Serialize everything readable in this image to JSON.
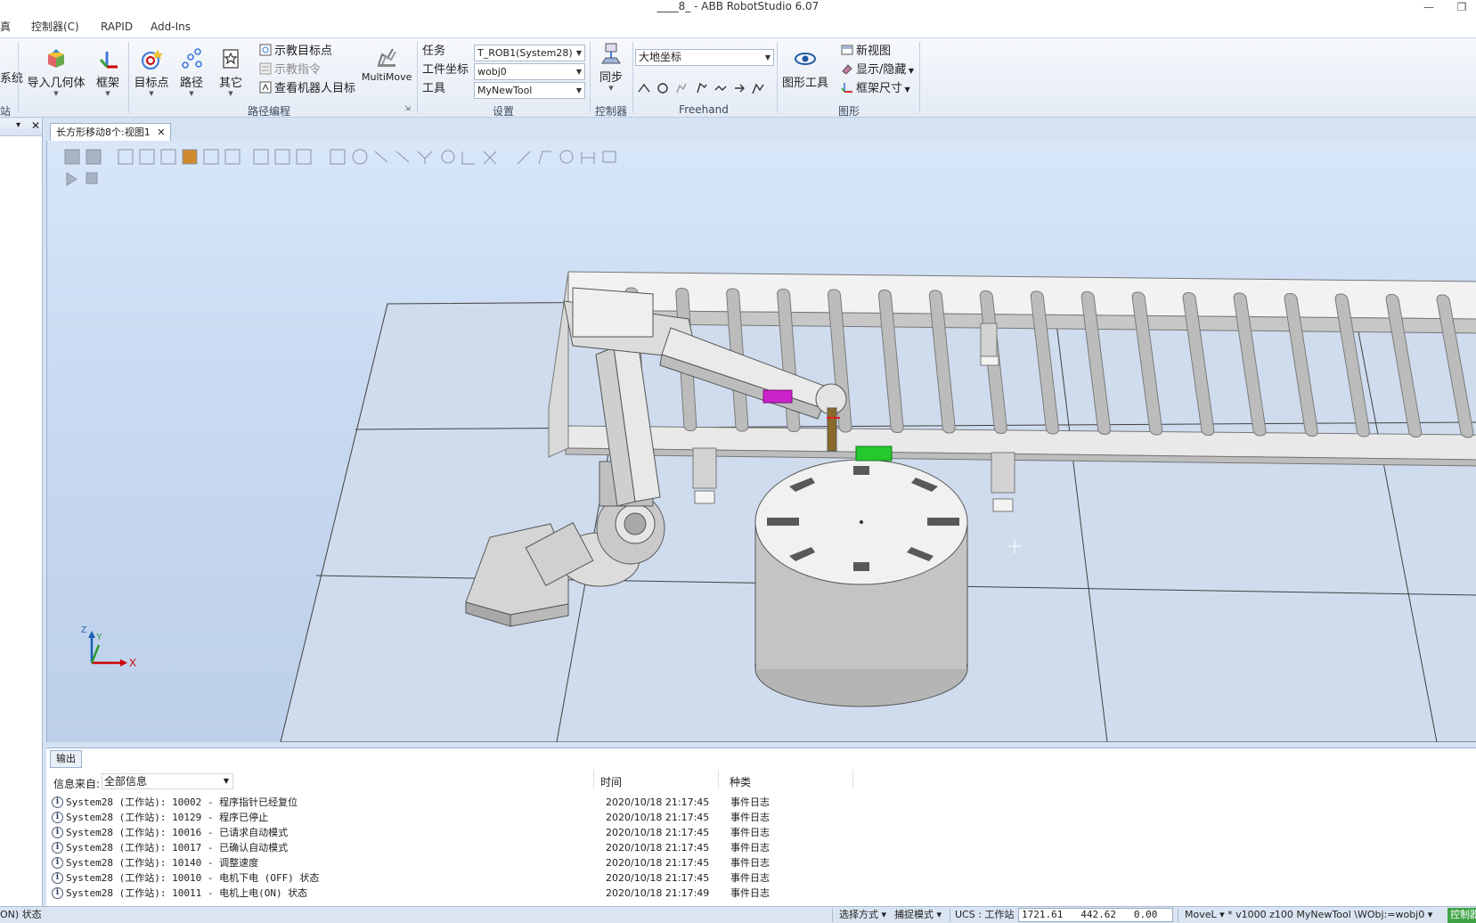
{
  "window": {
    "title": "____8_ - ABB RobotStudio 6.07",
    "minimize_glyph": "—",
    "restore_glyph": "❐"
  },
  "menu": {
    "tabs": [
      "真",
      "控制器(C)",
      "RAPID",
      "Add-Ins"
    ]
  },
  "ribbon": {
    "partial_left_label": "系统",
    "partial_group_label": "站",
    "import_geometry": "导入几何体",
    "frame": "框架",
    "target": "目标点",
    "path": "路径",
    "other": "其它",
    "teach_target": "示教目标点",
    "teach_instruction": "示教指令",
    "view_robot_target": "查看机器人目标",
    "multimove": "MultiMove",
    "group_path_programming": "路径编程",
    "task_label": "任务",
    "task_value": "T_ROB1(System28)",
    "wobj_label": "工件坐标",
    "wobj_value": "wobj0",
    "tool_label": "工具",
    "tool_value": "MyNewTool",
    "group_settings": "设置",
    "sync": "同步",
    "group_controller": "控制器",
    "ref_frame_value": "大地坐标",
    "group_freehand": "Freehand",
    "graphics_tools": "图形工具",
    "new_view": "新视图",
    "show_hide": "显示/隐藏",
    "frame_size": "框架尺寸",
    "group_graphics": "图形"
  },
  "document": {
    "tab_label": "长方形移动8个:视图1",
    "close_glyph": "✕"
  },
  "viewport": {
    "axis_x": "X",
    "axis_y": "Y",
    "axis_z": "Z"
  },
  "output": {
    "tab_label": "输出",
    "filter_label": "信息来自:",
    "filter_value": "全部信息",
    "col_time": "时间",
    "col_kind": "种类",
    "rows": [
      {
        "msg": "System28 (工作站): 10002 - 程序指针已经复位",
        "time": "2020/10/18 21:17:45",
        "kind": "事件日志"
      },
      {
        "msg": "System28 (工作站): 10129 - 程序已停止",
        "time": "2020/10/18 21:17:45",
        "kind": "事件日志"
      },
      {
        "msg": "System28 (工作站): 10016 - 已请求自动模式",
        "time": "2020/10/18 21:17:45",
        "kind": "事件日志"
      },
      {
        "msg": "System28 (工作站): 10017 - 已确认自动模式",
        "time": "2020/10/18 21:17:45",
        "kind": "事件日志"
      },
      {
        "msg": "System28 (工作站): 10140 - 调整速度",
        "time": "2020/10/18 21:17:45",
        "kind": "事件日志"
      },
      {
        "msg": "System28 (工作站): 10010 - 电机下电 (OFF) 状态",
        "time": "2020/10/18 21:17:45",
        "kind": "事件日志"
      },
      {
        "msg": "System28 (工作站): 10011 - 电机上电(ON) 状态",
        "time": "2020/10/18 21:17:49",
        "kind": "事件日志"
      }
    ]
  },
  "statusbar": {
    "left_status": "ON) 状态",
    "selection_mode": "选择方式 ▾",
    "snap_mode": "捕捉模式 ▾",
    "ucs": "UCS : 工作站",
    "coords": "1721.61   442.62   0.00",
    "instruction": "MoveL ▾  *  v1000  z100  MyNewTool  \\WObj:=wobj0 ▾",
    "controller_status": "控制器"
  }
}
